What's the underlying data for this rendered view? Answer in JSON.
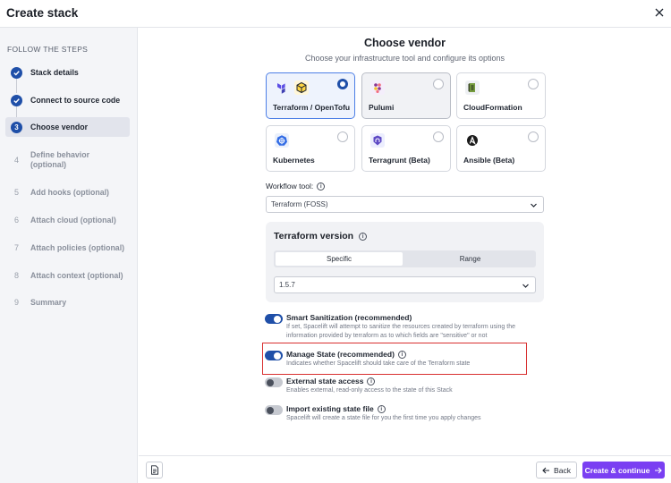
{
  "header": {
    "title": "Create stack"
  },
  "sidebar": {
    "heading": "FOLLOW THE STEPS",
    "steps": [
      {
        "number": "",
        "label": "Stack details",
        "state": "done"
      },
      {
        "number": "",
        "label": "Connect to source code",
        "state": "done"
      },
      {
        "number": "3",
        "label": "Choose vendor",
        "state": "current"
      },
      {
        "number": "4",
        "label": "Define behavior (optional)",
        "state": "todo"
      },
      {
        "number": "5",
        "label": "Add hooks (optional)",
        "state": "todo"
      },
      {
        "number": "6",
        "label": "Attach cloud (optional)",
        "state": "todo"
      },
      {
        "number": "7",
        "label": "Attach policies (optional)",
        "state": "todo"
      },
      {
        "number": "8",
        "label": "Attach context (optional)",
        "state": "todo"
      },
      {
        "number": "9",
        "label": "Summary",
        "state": "todo"
      }
    ]
  },
  "main": {
    "title": "Choose vendor",
    "subtitle": "Choose your infrastructure tool and configure its options",
    "vendors": [
      {
        "name": "Terraform / OpenTofu",
        "selected": true,
        "icon": "terraform-opentofu-icon"
      },
      {
        "name": "Pulumi",
        "selected": false,
        "icon": "pulumi-icon"
      },
      {
        "name": "CloudFormation",
        "selected": false,
        "icon": "cloudformation-icon"
      },
      {
        "name": "Kubernetes",
        "selected": false,
        "icon": "kubernetes-icon"
      },
      {
        "name": "Terragrunt (Beta)",
        "selected": false,
        "icon": "terragrunt-icon"
      },
      {
        "name": "Ansible (Beta)",
        "selected": false,
        "icon": "ansible-icon"
      }
    ],
    "workflow_tool": {
      "label": "Workflow tool:",
      "value": "Terraform (FOSS)"
    },
    "terraform_version": {
      "title": "Terraform version",
      "options": [
        "Specific",
        "Range"
      ],
      "selected": "Specific",
      "version": "1.5.7"
    },
    "toggles": [
      {
        "title": "Smart Sanitization (recommended)",
        "description": "If set, Spacelift will attempt to sanitize the resources created by terraform using the information provided by terraform as to which fields are \"sensitive\" or not",
        "on": true,
        "has_info": false
      },
      {
        "title": "Manage State (recommended)",
        "description": "Indicates whether Spacelift should take care of the Terraform state",
        "on": true,
        "has_info": true
      },
      {
        "title": "External state access",
        "description": "Enables external, read-only access to the state of this Stack",
        "on": false,
        "has_info": true
      },
      {
        "title": "Import existing state file",
        "description": "Spacelift will create a state file for you the first time you apply changes",
        "on": false,
        "has_info": true
      }
    ]
  },
  "footer": {
    "back_label": "Back",
    "next_label": "Create & continue"
  },
  "colors": {
    "accent": "#1f4fa8",
    "primary_button": "#7a3ff2",
    "highlight": "#d83030"
  }
}
